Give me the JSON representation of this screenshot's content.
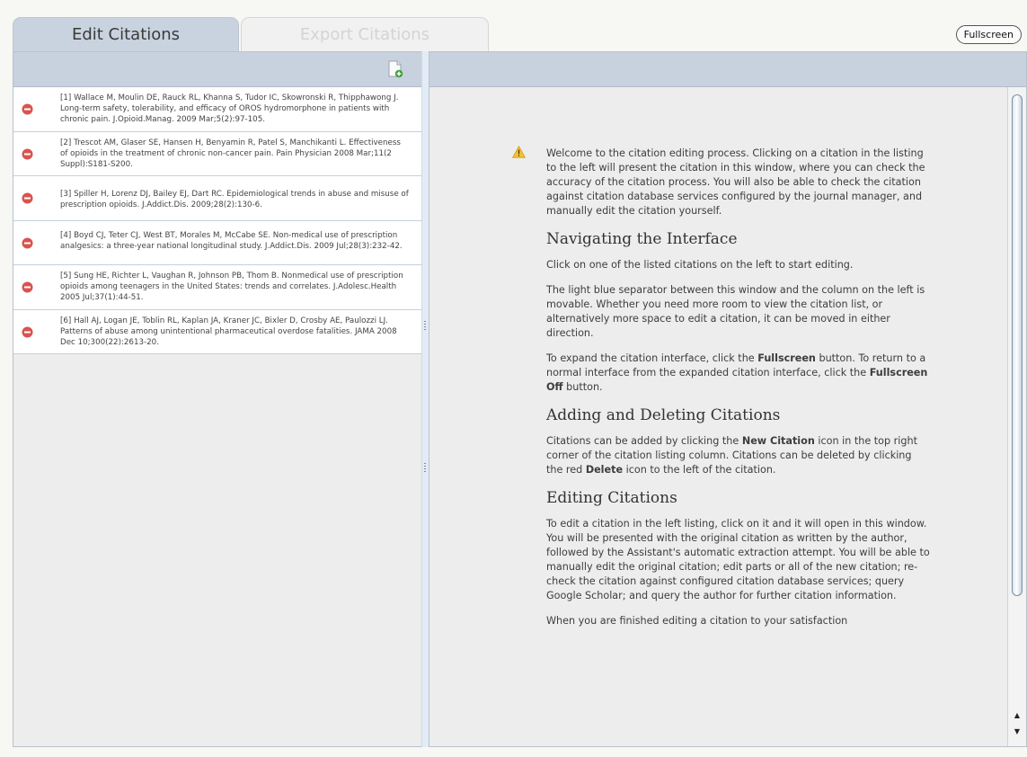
{
  "tabs": {
    "edit": "Edit Citations",
    "export": "Export Citations"
  },
  "toolbar": {
    "fullscreen_label": "Fullscreen"
  },
  "icons": {
    "new_citation": "new-citation-icon",
    "delete": "delete-icon",
    "warning": "warning-icon"
  },
  "citations": [
    "[1] Wallace M, Moulin DE, Rauck RL, Khanna S, Tudor IC, Skowronski R, Thipphawong J. Long-term safety, tolerability, and efficacy of OROS hydromorphone in patients with chronic pain. J.Opioid.Manag. 2009 Mar;5(2):97-105.",
    "[2] Trescot AM, Glaser SE, Hansen H, Benyamin R, Patel S, Manchikanti L. Effectiveness of opioids in the treatment of chronic non-cancer pain. Pain Physician 2008 Mar;11(2 Suppl):S181-S200.",
    "[3] Spiller H, Lorenz DJ, Bailey EJ, Dart RC. Epidemiological trends in abuse and misuse of prescription opioids. J.Addict.Dis. 2009;28(2):130-6.",
    "[4] Boyd CJ, Teter CJ, West BT, Morales M, McCabe SE. Non-medical use of prescription analgesics: a three-year national longitudinal study. J.Addict.Dis. 2009 Jul;28(3):232-42.",
    "[5] Sung HE, Richter L, Vaughan R, Johnson PB, Thom B. Nonmedical use of prescription opioids among teenagers in the United States: trends and correlates. J.Adolesc.Health 2005 Jul;37(1):44-51.",
    "[6] Hall AJ, Logan JE, Toblin RL, Kaplan JA, Kraner JC, Bixler D, Crosby AE, Paulozzi LJ. Patterns of abuse among unintentional pharmaceutical overdose fatalities. JAMA 2008 Dec 10;300(22):2613-20."
  ],
  "help": {
    "intro": "Welcome to the citation editing process. Clicking on a citation in the listing to the left will present the citation in this window, where you can check the accuracy of the citation process. You will also be able to check the citation against citation database services configured by the journal manager, and manually edit the citation yourself.",
    "nav_heading": "Navigating the Interface",
    "nav_p1": "Click on one of the listed citations on the left to start editing.",
    "nav_p2": "The light blue separator between this window and the column on the left is movable. Whether you need more room to view the citation list, or alternatively more space to edit a citation, it can be moved in either direction.",
    "nav_p3_a": "To expand the citation interface, click the ",
    "nav_p3_b": "Fullscreen",
    "nav_p3_c": " button. To return to a normal interface from the expanded citation interface, click the ",
    "nav_p3_d": "Fullscreen Off",
    "nav_p3_e": " button.",
    "add_heading": "Adding and Deleting Citations",
    "add_a": "Citations can be added by clicking the ",
    "add_b": "New Citation",
    "add_c": " icon in the top right corner of the citation listing column. Citations can be deleted by clicking the red ",
    "add_d": "Delete",
    "add_e": " icon to the left of the citation.",
    "edit_heading": "Editing Citations",
    "edit_p1": "To edit a citation in the left listing, click on it and it will open in this window. You will be presented with the original citation as written by the author, followed by the Assistant's automatic extraction attempt. You will be able to manually edit the original citation; edit parts or all of the new citation; re-check the citation against configured citation database services; query Google Scholar; and query the author for further citation information.",
    "finish_p": "When you are finished editing a citation to your satisfaction"
  },
  "scrollbar": {
    "up": "▲",
    "down": "▼"
  }
}
